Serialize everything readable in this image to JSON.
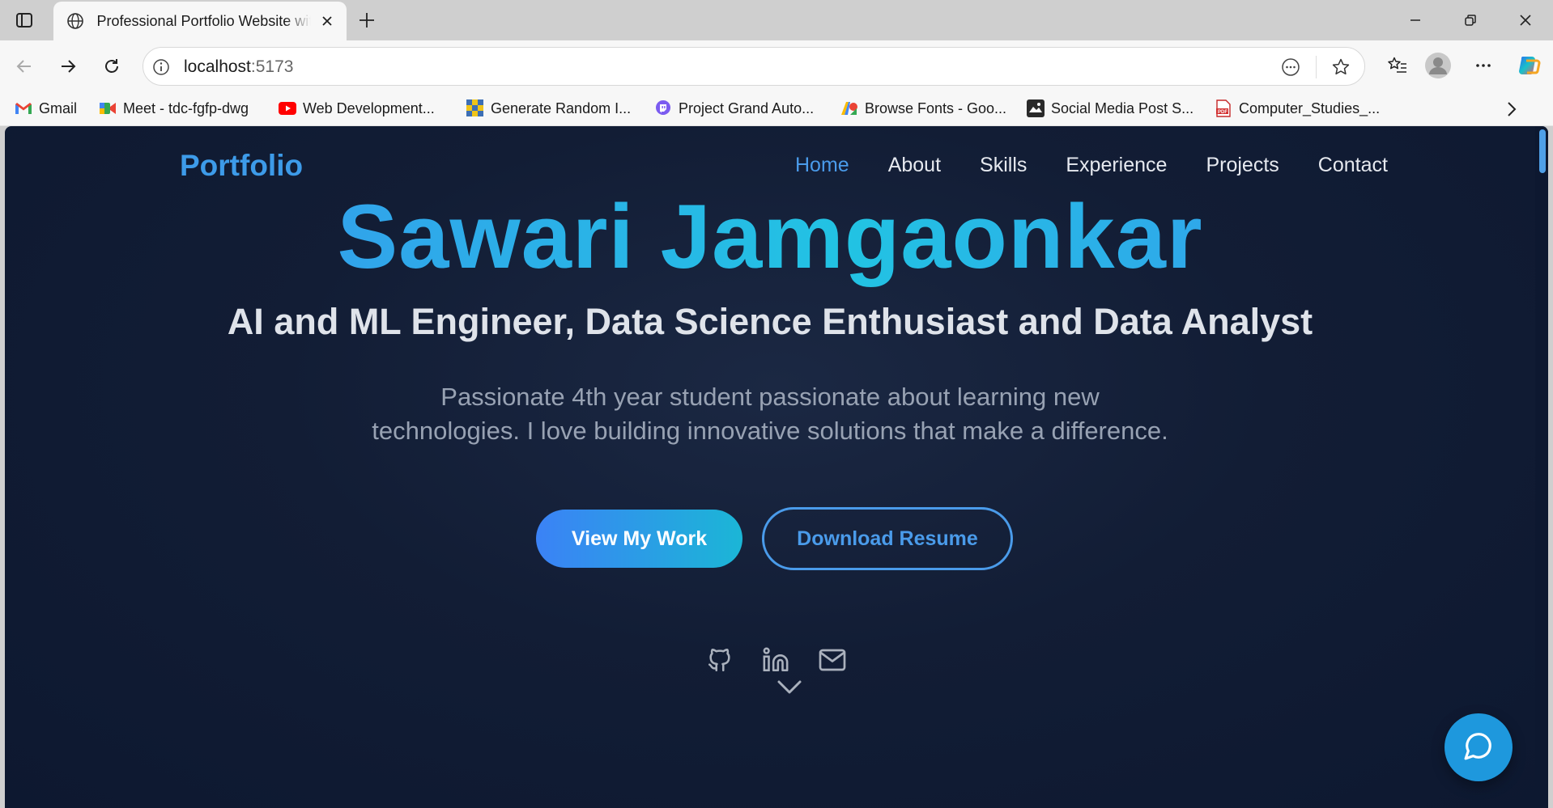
{
  "browser": {
    "tab_title": "Professional Portfolio Website wit",
    "url_host": "localhost",
    "url_port": ":5173",
    "bookmarks": [
      {
        "label": "Gmail",
        "icon": "gmail-icon"
      },
      {
        "label": "Meet - tdc-fgfp-dwg",
        "icon": "meet-icon"
      },
      {
        "label": "Web Development...",
        "icon": "youtube-icon"
      },
      {
        "label": "Generate Random I...",
        "icon": "pixel-grid-icon"
      },
      {
        "label": "Project Grand Auto...",
        "icon": "twitch-icon"
      },
      {
        "label": "Browse Fonts - Goo...",
        "icon": "google-fonts-icon"
      },
      {
        "label": "Social Media Post S...",
        "icon": "social-media-icon"
      },
      {
        "label": "Computer_Studies_...",
        "icon": "pdf-icon"
      }
    ]
  },
  "site": {
    "logo": "Portfolio",
    "nav": [
      "Home",
      "About",
      "Skills",
      "Experience",
      "Projects",
      "Contact"
    ],
    "active_nav": "Home",
    "hero": {
      "name": "Sawari Jamgaonkar",
      "subtitle": "AI and ML Engineer, Data Science Enthusiast and Data Analyst",
      "description": "Passionate 4th year student passionate about learning new technologies. I love building innovative solutions that make a difference.",
      "primary_cta": "View My Work",
      "secondary_cta": "Download Resume"
    },
    "socials": [
      "github-icon",
      "linkedin-icon",
      "mail-icon"
    ]
  },
  "colors": {
    "accent": "#4a9bea",
    "background": "#121d35",
    "gradient_start": "#3b82f6",
    "gradient_end": "#1bb6d6",
    "chat_button": "#1e98dd"
  }
}
